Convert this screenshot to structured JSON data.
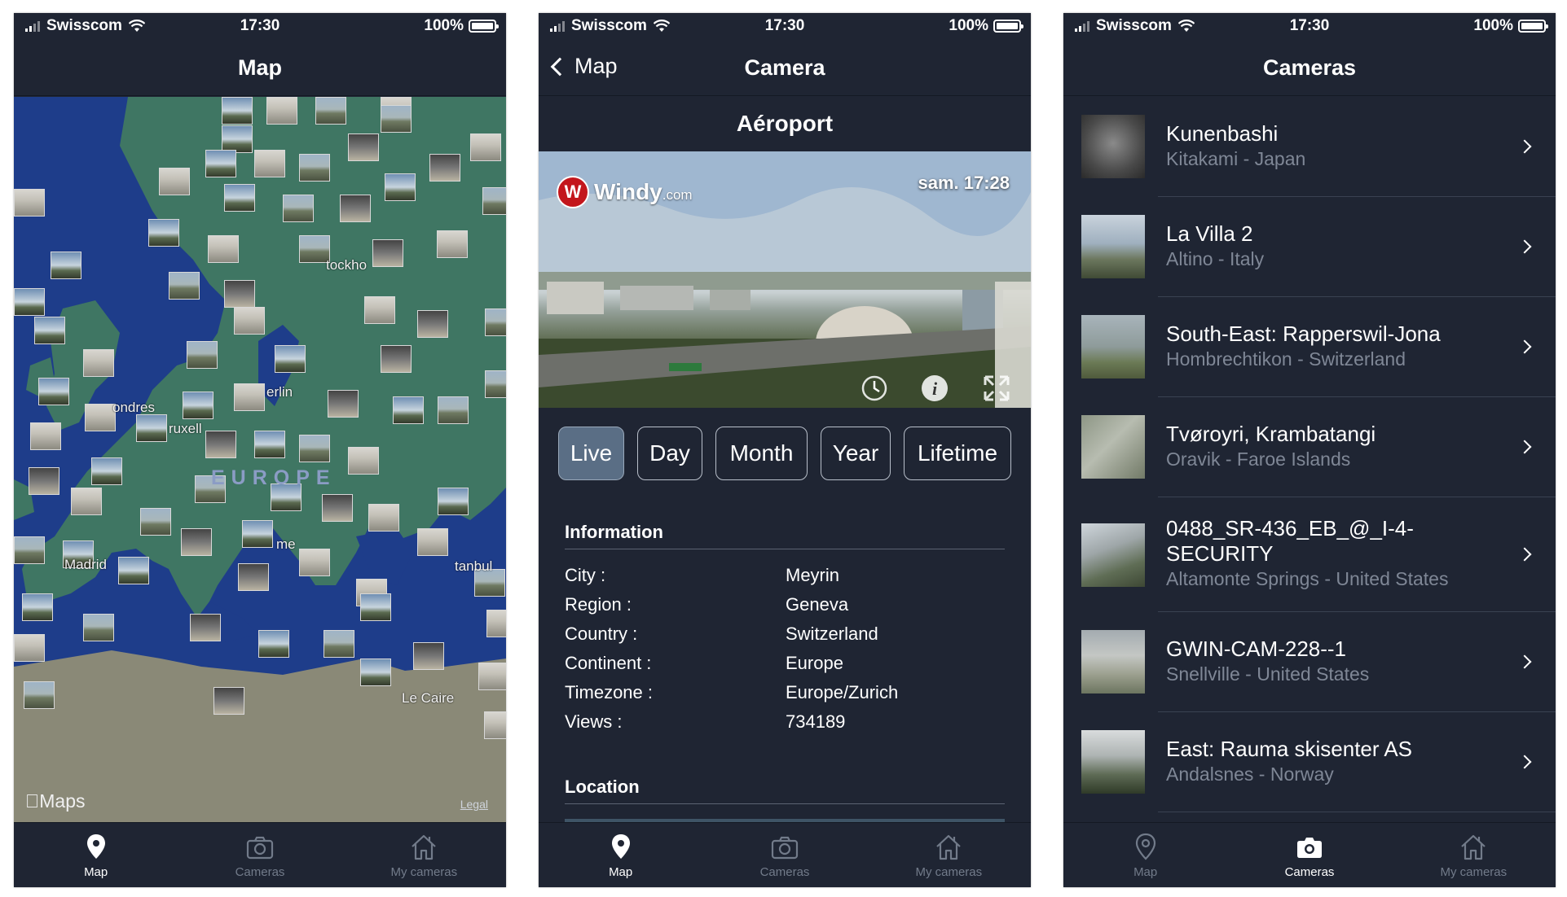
{
  "status_bar": {
    "carrier": "Swisscom",
    "time": "17:30",
    "battery": "100%"
  },
  "tabs": [
    {
      "label": "Map",
      "icon": "map-pin-icon"
    },
    {
      "label": "Cameras",
      "icon": "camera-icon"
    },
    {
      "label": "My cameras",
      "icon": "home-icon"
    }
  ],
  "screen_map": {
    "title": "Map",
    "labels": {
      "stockholm": "tockho",
      "berlin": "erlin",
      "londres": "ondres",
      "bruxelles": "ruxell",
      "europe": "EUROPE",
      "madrid": "Madrid",
      "rome": "me",
      "istanbul": "tanbul",
      "le_caire": "Le Caire"
    },
    "maps_brand": "Maps",
    "legal": "Legal",
    "active_tab": "Map"
  },
  "screen_camera": {
    "back_label": "Map",
    "title": "Camera",
    "camera_name": "Aéroport",
    "image_overlay": {
      "brand": "Windy",
      "brand_suffix": ".com",
      "timestamp": "sam. 17:28"
    },
    "periods": [
      "Live",
      "Day",
      "Month",
      "Year",
      "Lifetime"
    ],
    "active_period": "Live",
    "information_title": "Information",
    "info": [
      {
        "key": "City :",
        "value": "Meyrin"
      },
      {
        "key": "Region :",
        "value": "Geneva"
      },
      {
        "key": "Country :",
        "value": "Switzerland"
      },
      {
        "key": "Continent :",
        "value": "Europe"
      },
      {
        "key": "Timezone :",
        "value": "Europe/Zurich"
      },
      {
        "key": "Views :",
        "value": "734189"
      }
    ],
    "location_title": "Location",
    "active_tab": "Map"
  },
  "screen_cameras": {
    "title": "Cameras",
    "items": [
      {
        "name": "Kunenbashi",
        "location": "Kitakami - Japan"
      },
      {
        "name": "La Villa 2",
        "location": "Altino - Italy"
      },
      {
        "name": "South-East: Rapperswil-Jona",
        "location": "Hombrechtikon - Switzerland"
      },
      {
        "name": "Tvøroyri, Krambatangi",
        "location": "Oravik - Faroe Islands"
      },
      {
        "name": "0488_SR-436_EB_@_I-4-SECURITY",
        "location": "Altamonte Springs - United States"
      },
      {
        "name": "GWIN-CAM-228--1",
        "location": "Snellville - United States"
      },
      {
        "name": "East: Rauma skisenter AS",
        "location": "Andalsnes - Norway"
      }
    ],
    "active_tab": "Cameras"
  },
  "colors": {
    "background": "#1f2533",
    "sea": "#1e3d8a",
    "land": "#3f7663",
    "africa": "#8a8977",
    "active_period": "#5a6e85",
    "muted_text": "#7f8796"
  }
}
